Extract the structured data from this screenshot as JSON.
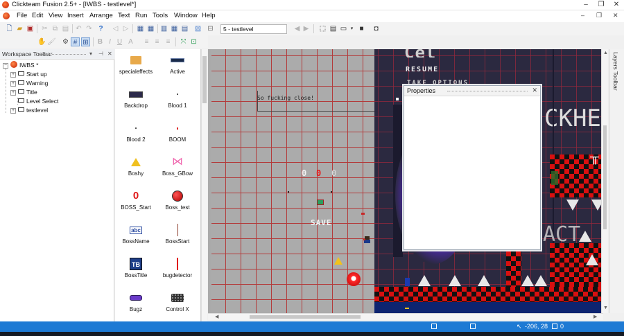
{
  "window": {
    "title": "Clickteam Fusion 2.5+ - [IWBS - testlevel*]",
    "controls": [
      "–",
      "❐",
      "✕"
    ],
    "mdi_controls": [
      "–",
      "❐",
      "✕"
    ]
  },
  "menu": [
    "File",
    "Edit",
    "View",
    "Insert",
    "Arrange",
    "Text",
    "Run",
    "Tools",
    "Window",
    "Help"
  ],
  "toolbar": {
    "frame_selector": "5 - testlevel"
  },
  "workspace": {
    "header": "Workspace Toolbar",
    "header_controls": [
      "▾",
      "⊣",
      "✕"
    ],
    "root": "IWBS *",
    "frames": [
      "Start up",
      "Warning",
      "Title",
      "Level Select",
      "testlevel"
    ]
  },
  "objects": [
    {
      "label": "specialeffects",
      "icon": "folder-icon"
    },
    {
      "label": "Active",
      "icon": "active-sprite-icon"
    },
    {
      "label": "Backdrop",
      "icon": "backdrop-icon"
    },
    {
      "label": "Blood 1",
      "icon": "dot-icon"
    },
    {
      "label": "Blood 2",
      "icon": "dot-icon"
    },
    {
      "label": "BOOM",
      "icon": "red-dot-icon"
    },
    {
      "label": "Boshy",
      "icon": "boshy-icon"
    },
    {
      "label": "Boss_GBow",
      "icon": "bow-icon"
    },
    {
      "label": "BOSS_Start",
      "icon": "counter-zero-icon"
    },
    {
      "label": "Boss_test",
      "icon": "apple-icon"
    },
    {
      "label": "BossName",
      "icon": "abc-text-icon"
    },
    {
      "label": "BossStart",
      "icon": "vertical-line-icon"
    },
    {
      "label": "BossTitle",
      "icon": "title-tb-icon"
    },
    {
      "label": "bugdetector",
      "icon": "red-bar-icon"
    },
    {
      "label": "Bugz",
      "icon": "bug-car-icon"
    },
    {
      "label": "Control X",
      "icon": "keyboard-icon"
    }
  ],
  "scene": {
    "sign_text": "So fucking close!",
    "counter_digits": [
      "0",
      "0",
      "0"
    ],
    "save_text": "SAVE",
    "menu_resume": "RESUME",
    "menu_partial": "TAKE OPTIONS",
    "title_fragment": "CKHE",
    "lower_fragment": "ACT"
  },
  "properties": {
    "title": "Properties"
  },
  "layers_toolbar": "Layers Toolbar",
  "status": {
    "coords": "-206, 28",
    "extra": "0"
  },
  "colors": {
    "statusbar": "#1e7ad4",
    "grid_red": "#b33b3b",
    "scene_dark": "#2b2940",
    "checker_red": "#d81010"
  }
}
